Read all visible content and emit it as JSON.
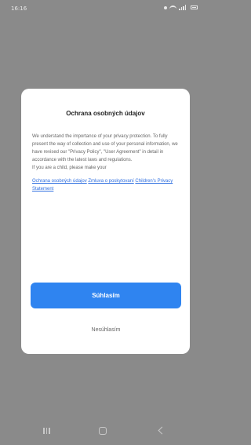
{
  "status_bar": {
    "time": "16:16",
    "right_text": "",
    "icons": [
      "notification-dot-icon",
      "wifi-icon",
      "signal-icon",
      "battery-icon"
    ]
  },
  "dialog": {
    "title": "Ochrana osobných údajov",
    "body_paragraph_1": "We understand the importance of your privacy protection. To fully present the way of collection and use of your personal information, we have revised our \"Privacy Policy\", \"User Agreement\" in detail in accordance with the latest laws and regulations.",
    "body_paragraph_2": "If you are a child, please make your",
    "links": [
      "Ochrana osobných údajov",
      "Zmluva o poskytovaní",
      "Children's Privacy Statement"
    ],
    "agree_label": "Súhlasím",
    "disagree_label": "Nesúhlasím"
  },
  "navigation_bar": {
    "icons": [
      "recent-apps-icon",
      "home-icon",
      "back-icon"
    ]
  },
  "colors": {
    "overlay": "#8a8a8a",
    "dialog_background": "#ffffff",
    "primary_button": "#2f84f0",
    "link": "#2f6fe0",
    "body_text": "#666666",
    "title_text": "#222222"
  }
}
